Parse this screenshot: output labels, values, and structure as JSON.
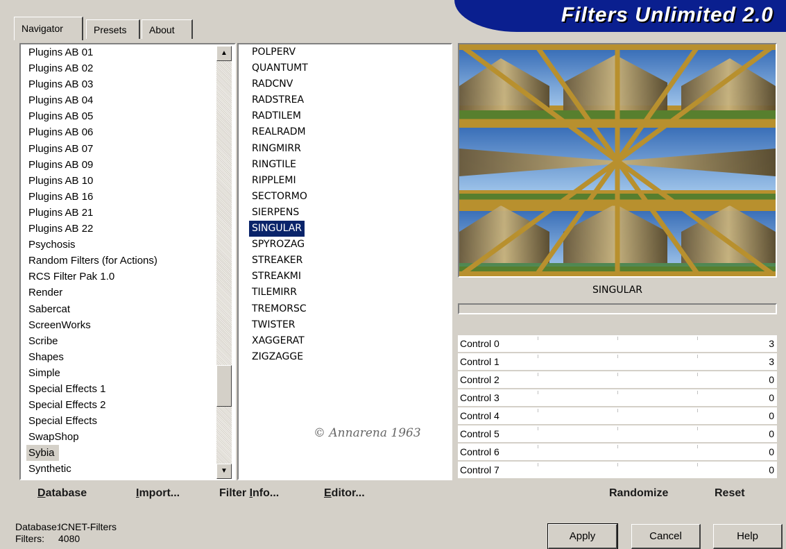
{
  "tabs": [
    {
      "label": "Navigator",
      "active": true
    },
    {
      "label": "Presets",
      "active": false
    },
    {
      "label": "About",
      "active": false
    }
  ],
  "banner": {
    "title": "Filters Unlimited 2.0"
  },
  "categories": {
    "items": [
      "Plugins AB 01",
      "Plugins AB 02",
      "Plugins AB 03",
      "Plugins AB 04",
      "Plugins AB 05",
      "Plugins AB 06",
      "Plugins AB 07",
      "Plugins AB 09",
      "Plugins AB 10",
      "Plugins AB 16",
      "Plugins AB 21",
      "Plugins AB 22",
      "Psychosis",
      "Random Filters (for Actions)",
      "RCS Filter Pak 1.0",
      "Render",
      "Sabercat",
      "ScreenWorks",
      "Scribe",
      "Shapes",
      "Simple",
      "Special Effects 1",
      "Special Effects 2",
      "Special Effects",
      "SwapShop",
      "Sybia",
      "Synthetic"
    ],
    "selected": "Sybia"
  },
  "filters": {
    "items": [
      "POLPERV",
      "QUANTUMT",
      "RADCNV",
      "RADSTREA",
      "RADTILEM",
      "REALRADM",
      "RINGMIRR",
      "RINGTILE",
      "RIPPLEMI",
      "SECTORMO",
      "SIERPENS",
      "SINGULAR",
      "SPYROZAG",
      "STREAKER",
      "STREAKMI",
      "TILEMIRR",
      "TREMORSC",
      "TWISTER",
      "XAGGERAT",
      "ZIGZAGGE"
    ],
    "selected": "SINGULAR",
    "watermark": "© Annarena 1963"
  },
  "preview": {
    "filter_name": "SINGULAR"
  },
  "controls": [
    {
      "label": "Control 0",
      "value": "3"
    },
    {
      "label": "Control 1",
      "value": "3"
    },
    {
      "label": "Control 2",
      "value": "0"
    },
    {
      "label": "Control 3",
      "value": "0"
    },
    {
      "label": "Control 4",
      "value": "0"
    },
    {
      "label": "Control 5",
      "value": "0"
    },
    {
      "label": "Control 6",
      "value": "0"
    },
    {
      "label": "Control 7",
      "value": "0"
    }
  ],
  "toolbar": {
    "database_first": "D",
    "database_rest": "atabase",
    "import_first": "I",
    "import_rest": "mport...",
    "filter_info_pre": "Filter ",
    "filter_info_u": "I",
    "filter_info_post": "nfo...",
    "editor_first": "E",
    "editor_rest": "ditor...",
    "randomize": "Randomize",
    "reset": "Reset"
  },
  "status": {
    "database_label": "Database:",
    "database_value": "ICNET-Filters",
    "filters_label": "Filters:",
    "filters_value": "4080"
  },
  "buttons": {
    "apply": "Apply",
    "cancel": "Cancel",
    "help": "Help"
  },
  "colors": {
    "banner": "#0a1f8f",
    "selection": "#0a246a",
    "face": "#d4d0c8"
  }
}
